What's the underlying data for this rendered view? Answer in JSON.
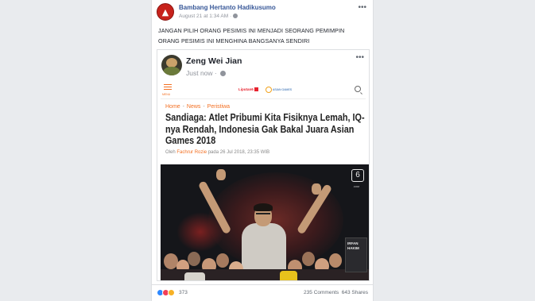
{
  "post": {
    "author": "Bambang Hertanto Hadikusumo",
    "timestamp": "August 21 at 1:34 AM",
    "more_icon": "more-icon",
    "text_line1": "JANGAN PILIH ORANG PESIMIS INI MENJADI SEORANG PEMIMPIN",
    "text_line2": "ORANG PESIMIS INI MENGHINA BANGSANYA SENDIRI"
  },
  "shared": {
    "author": "Zeng Wei Jian",
    "timestamp": "Just now ·",
    "article": {
      "menu_label": "MENU",
      "logo_text": "Liputan6",
      "logo2_text": "ASIAN GAMES",
      "breadcrumbs": [
        "Home",
        "News",
        "Peristiwa"
      ],
      "headline": "Sandiaga: Atlet Pribumi Kita Fisiknya Lemah, IQ-nya Rendah, Indonesia Gak Bakal Juara Asian Games 2018",
      "byline_prefix": "Oleh",
      "byline_author": "Fachrur Rozie",
      "byline_date": "pada 26 Jul 2018, 23:35 WIB",
      "watermark": "6",
      "watermark_sub": ".COM",
      "banner_text": "IRFAN HAKIM"
    }
  },
  "footer": {
    "reaction_count": "373",
    "comments": "235 Comments",
    "shares": "643 Shares"
  },
  "colors": {
    "link": "#385898",
    "accent": "#f36f21",
    "page_bg": "#e9ebee"
  }
}
